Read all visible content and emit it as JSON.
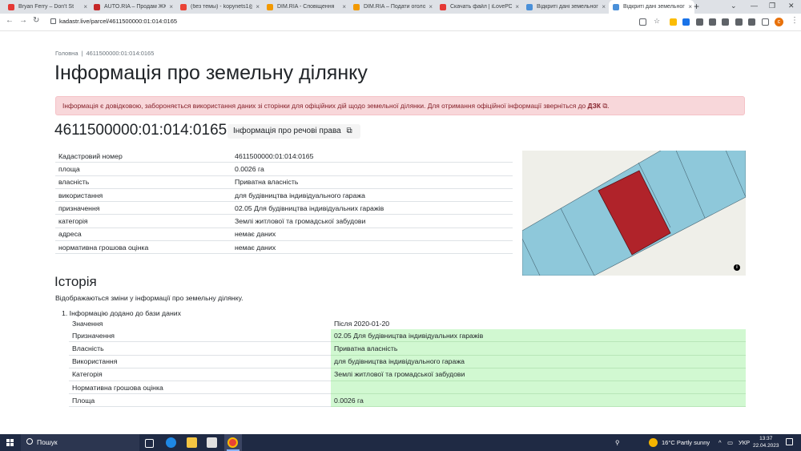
{
  "browser": {
    "tabs": [
      {
        "title": "Bryan Ferry – Don't St",
        "color": "#e53935"
      },
      {
        "title": "AUTO.RIA – Продам ЖК 2",
        "color": "#c62828"
      },
      {
        "title": "(без темы) - kopynets1@",
        "color": "#ea4335"
      },
      {
        "title": "DIM.RIA - Сповіщення",
        "color": "#f29900"
      },
      {
        "title": "DIM.RIA – Подати оголош",
        "color": "#f29900"
      },
      {
        "title": "Скачать файл | iLovePDF",
        "color": "#e53935"
      },
      {
        "title": "Відкриті дані земельного",
        "color": "#4a90d9"
      },
      {
        "title": "Відкриті дані земельного",
        "color": "#4a90d9"
      }
    ],
    "url": "kadastr.live/parcel/4611500000:01:014:0165"
  },
  "breadcrumb": {
    "home": "Головна",
    "separator": "|",
    "current": "4611500000:01:014:0165"
  },
  "page_title": "Інформація про земельну ділянку",
  "alert": {
    "text": "Інформація є довідковою, забороняється використання даних зі сторінки для офіційних дій щодо земельної ділянки. Для отримання офіційної інформації зверніться до ",
    "link": "ДЗК",
    "end": "."
  },
  "cadastral_number": "4611500000:01:014:0165",
  "rights_button": "Інформація про речові права",
  "info": [
    {
      "label": "Кадастровий номер",
      "value": "4611500000:01:014:0165"
    },
    {
      "label": "площа",
      "value": "0.0026 га"
    },
    {
      "label": "власність",
      "value": "Приватна власність"
    },
    {
      "label": "використання",
      "value": "для будівництва індивідуального гаража"
    },
    {
      "label": "призначення",
      "value": "02.05 Для будівництва індивідуальних гаражів"
    },
    {
      "label": "категорія",
      "value": "Землі житлової та громадської забудови"
    },
    {
      "label": "адреса",
      "value": "немає даних"
    },
    {
      "label": "нормативна грошова оцінка",
      "value": "немає даних"
    }
  ],
  "map": {
    "parcel_color": "#b0232a",
    "neighbor_color": "#8ec8da",
    "background": "#efefe9"
  },
  "history": {
    "title": "Історія",
    "description": "Відображаються зміни у інформації про земельну ділянку.",
    "item_number": "1.",
    "item_title": "Інформацію додано до бази даних",
    "header_key": "Значення",
    "header_value": "Після 2020-01-20",
    "rows": [
      {
        "label": "Призначення",
        "value": "02.05 Для будівництва індивідуальних гаражів"
      },
      {
        "label": "Власність",
        "value": "Приватна власність"
      },
      {
        "label": "Використання",
        "value": "для будівництва індивідуального гаража"
      },
      {
        "label": "Категорія",
        "value": "Землі житлової та громадської забудови"
      },
      {
        "label": "Нормативна грошова оцінка",
        "value": ""
      },
      {
        "label": "Площа",
        "value": "0.0026 га"
      }
    ]
  },
  "taskbar": {
    "search": "Пошук",
    "weather": "16°C  Partly sunny",
    "lang": "УКР",
    "time": "13:37",
    "date": "22.04.2023"
  }
}
